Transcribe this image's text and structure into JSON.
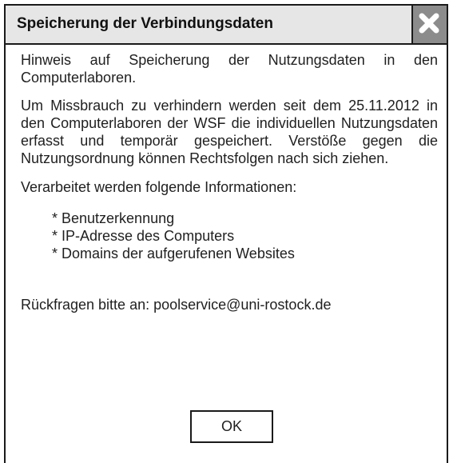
{
  "dialog": {
    "title": "Speicherung der Verbindungsdaten",
    "close_icon": "close-x-icon",
    "paragraphs": {
      "intro": "Hinweis auf Speicherung der Nutzungsdaten in den Computerlaboren.",
      "body": "Um Missbrauch zu verhindern werden seit dem 25.11.2012 in den Computerlaboren der WSF die individuellen Nutzungsdaten erfasst und temporär gespeichert. Verstöße gegen die Nutzungsordnung können Rechtsfolgen nach sich ziehen.",
      "list_intro": "Verarbeitet werden folgende Informationen:",
      "contact": "Rückfragen bitte an: poolservice@uni-rostock.de"
    },
    "list_items": [
      "* Benutzerkennung",
      "* IP-Adresse des Computers",
      "* Domains der aufgerufenen Websites"
    ],
    "ok_label": "OK"
  },
  "colors": {
    "titlebar_bg": "#e6e6e6",
    "close_button_bg": "#8c8c8c",
    "border": "#1a1a1a",
    "text": "#1f1f1f"
  }
}
